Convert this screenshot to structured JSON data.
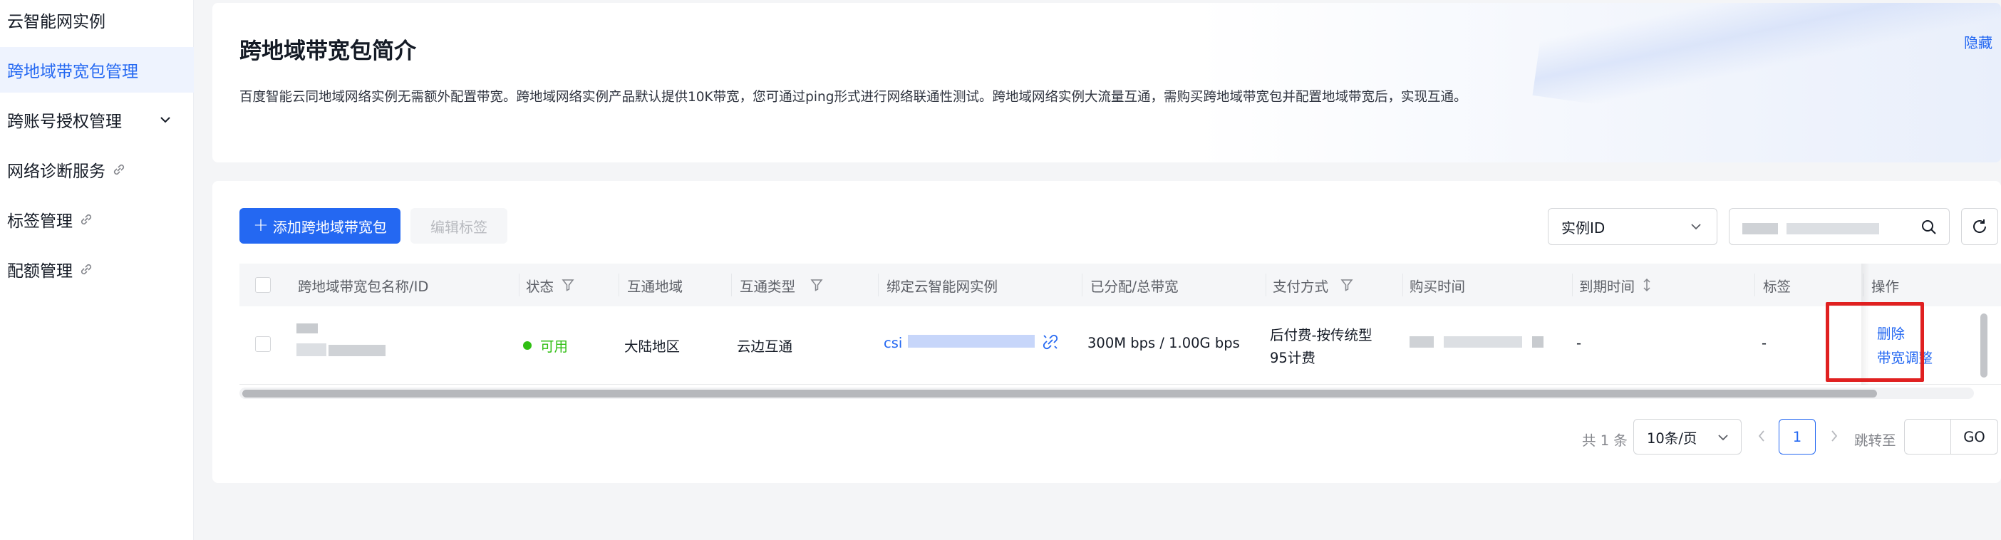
{
  "sidebar": {
    "items": [
      {
        "label": "云智能网实例"
      },
      {
        "label": "跨地域带宽包管理"
      },
      {
        "label": "跨账号授权管理"
      },
      {
        "label": "网络诊断服务"
      },
      {
        "label": "标签管理"
      },
      {
        "label": "配额管理"
      }
    ]
  },
  "intro": {
    "title": "跨地域带宽包简介",
    "description": "百度智能云同地域网络实例无需额外配置带宽。跨地域网络实例产品默认提供10K带宽，您可通过ping形式进行网络联通性测试。跨地域网络实例大流量互通，需购买跨地域带宽包并配置地域带宽后，实现互通。",
    "hide_label": "隐藏"
  },
  "toolbar": {
    "add_label": "添加跨地域带宽包",
    "edit_tags_label": "编辑标签",
    "search_field_selected": "实例ID"
  },
  "table": {
    "headers": {
      "name": "跨地域带宽包名称/ID",
      "status": "状态",
      "region": "互通地域",
      "type": "互通类型",
      "instance": "绑定云智能网实例",
      "bandwidth": "已分配/总带宽",
      "payment": "支付方式",
      "purchase_time": "购买时间",
      "expire_time": "到期时间",
      "tags": "标签",
      "actions": "操作"
    },
    "rows": [
      {
        "status": "可用",
        "region": "大陆地区",
        "type": "云边互通",
        "instance_prefix": "csi",
        "bandwidth": "300M bps / 1.00G bps",
        "payment_line1": "后付费-按传统型",
        "payment_line2": "95计费",
        "expire_time": "-",
        "tags": "-",
        "action_delete": "删除",
        "action_adjust": "带宽调整"
      }
    ]
  },
  "pagination": {
    "total": "共 1 条",
    "page_size": "10条/页",
    "current_page": "1",
    "jump_label": "跳转至",
    "go_label": "GO"
  },
  "colors": {
    "primary": "#2468f2",
    "success": "#30bf13",
    "highlight": "#e02020"
  }
}
